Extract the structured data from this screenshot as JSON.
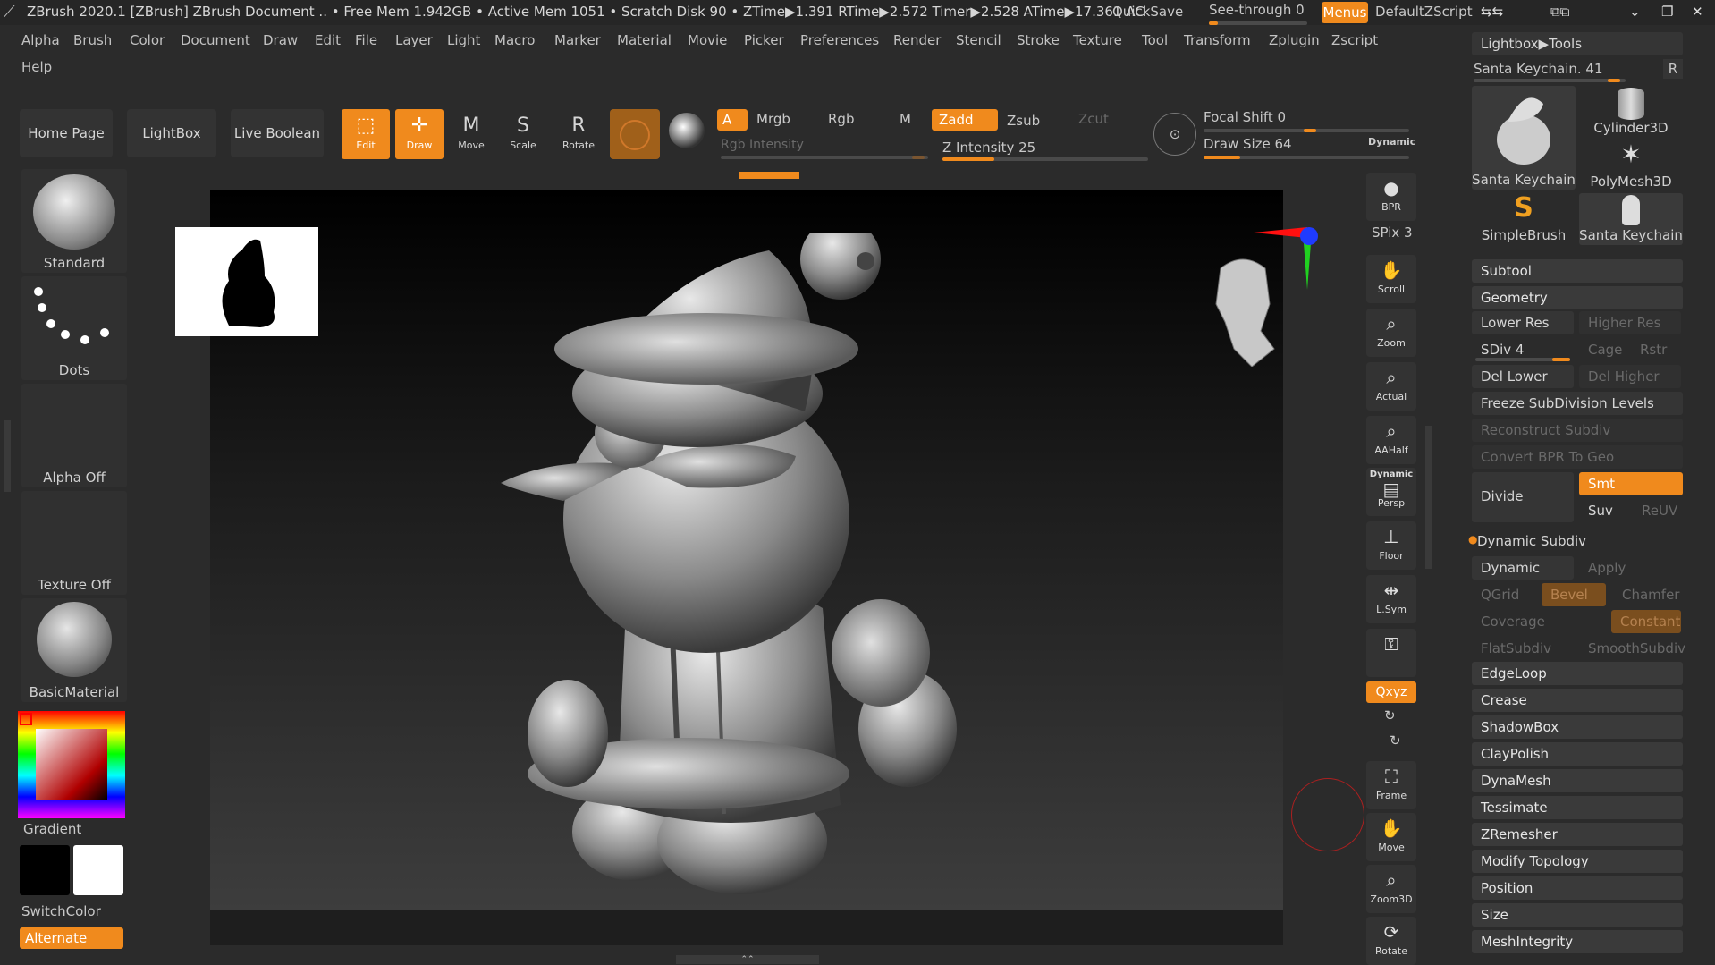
{
  "title_bar": {
    "text": "ZBrush 2020.1 [ZBrush]   ZBrush Document    .. • Free Mem 1.942GB • Active Mem 1051 • Scratch Disk 90 •  ZTime▶1.391 RTime▶2.572 Timer▶2.528 ATime▶17.361  AC",
    "quicksave": "QuickSave",
    "see_through": "See-through  0",
    "menus": "Menus",
    "default_zscript": "DefaultZScript"
  },
  "menus": [
    "Alpha",
    "Brush",
    "Color",
    "Document",
    "Draw",
    "Edit",
    "File",
    "Layer",
    "Light",
    "Macro",
    "Marker",
    "Material",
    "Movie",
    "Picker",
    "Preferences",
    "Render",
    "Stencil",
    "Stroke",
    "Texture",
    "Tool",
    "Transform",
    "Zplugin",
    "Zscript"
  ],
  "help": "Help",
  "toolbar": {
    "home_page": "Home Page",
    "lightbox": "LightBox",
    "live_boolean": "Live Boolean",
    "edit": "Edit",
    "draw": "Draw",
    "move": "Move",
    "scale": "Scale",
    "rotate": "Rotate",
    "a": "A",
    "mrgb": "Mrgb",
    "rgb": "Rgb",
    "m": "M",
    "zadd": "Zadd",
    "zsub": "Zsub",
    "zcut": "Zcut",
    "rgb_intensity": "Rgb Intensity",
    "z_intensity": "Z Intensity 25",
    "z_intensity_value": 25,
    "focal_shift": "Focal Shift 0",
    "draw_size": "Draw Size 64",
    "draw_size_value": 64,
    "dynamic": "Dynamic"
  },
  "left_shelf": {
    "brush": "Standard",
    "stroke": "Dots",
    "alpha": "Alpha Off",
    "texture": "Texture Off",
    "material": "BasicMaterial",
    "gradient": "Gradient",
    "switch_color": "SwitchColor",
    "alternate": "Alternate"
  },
  "right_tools": {
    "bpr": "BPR",
    "spix": "SPix 3",
    "scroll": "Scroll",
    "zoom": "Zoom",
    "actual": "Actual",
    "aahalf": "AAHalf",
    "dynamic": "Dynamic",
    "persp": "Persp",
    "floor": "Floor",
    "lsym": "L.Sym",
    "xyz": "Qxyz",
    "frame": "Frame",
    "move": "Move",
    "zoom3d": "Zoom3D",
    "rotate": "Rotate"
  },
  "right_panel": {
    "header": "Lightbox▶Tools",
    "current_tool": "Santa Keychain. 41",
    "r_btn": "R",
    "tools": [
      "Santa Keychain",
      "Cylinder3D",
      "PolyMesh3D",
      "SimpleBrush",
      "Santa Keychain"
    ],
    "subtool": "Subtool",
    "geometry": "Geometry",
    "lower_res": "Lower Res",
    "higher_res": "Higher Res",
    "sdiv": "SDiv 4",
    "cage": "Cage",
    "rstr": "Rstr",
    "del_lower": "Del Lower",
    "del_higher": "Del Higher",
    "freeze": "Freeze SubDivision Levels",
    "reconstruct": "Reconstruct Subdiv",
    "convert_bpr": "Convert BPR To Geo",
    "divide": "Divide",
    "smt": "Smt",
    "suv": "Suv",
    "reuv": "ReUV",
    "dynamic_subdiv": "Dynamic Subdiv",
    "dynamic": "Dynamic",
    "apply": "Apply",
    "qgrid": "QGrid",
    "bevel": "Bevel",
    "chamfer": "Chamfer",
    "coverage": "Coverage",
    "constant": "Constant",
    "flat_subdiv": "FlatSubdiv",
    "smooth_subdiv": "SmoothSubdiv",
    "sections": [
      "EdgeLoop",
      "Crease",
      "ShadowBox",
      "ClayPolish",
      "DynaMesh",
      "Tessimate",
      "ZRemesher",
      "Modify Topology",
      "Position",
      "Size",
      "MeshIntegrity"
    ]
  }
}
